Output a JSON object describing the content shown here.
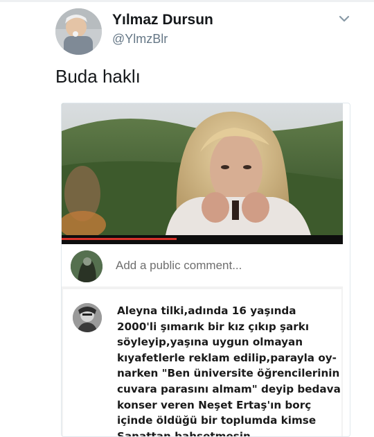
{
  "tweet": {
    "display_name": "Yılmaz Dursun",
    "handle": "@YlmzBlr",
    "text": "Buda haklı",
    "avatar_icon": "user-avatar-photo",
    "menu_icon": "chevron-down-icon"
  },
  "video": {
    "progress": 0.41,
    "progress_color": "#d9342b",
    "comment_placeholder": "Add a public comment...",
    "comment": {
      "lines": [
        "Aleyna tilki,adında 16 yaşında",
        "2000'li şımarık bir kız çıkıp şarkı",
        "söyleyip,yaşına uygun olmayan",
        "kıyafetlerle reklam edilip,parayla oy-",
        "narken \"Ben üniversite öğrencilerinin",
        "cuvara parasını almam\" deyip bedava",
        "konser veren Neşet Ertaş'ın borç",
        "içinde öldüğü bir toplumda kimse",
        "Sanattan bahsetmesin"
      ]
    }
  }
}
